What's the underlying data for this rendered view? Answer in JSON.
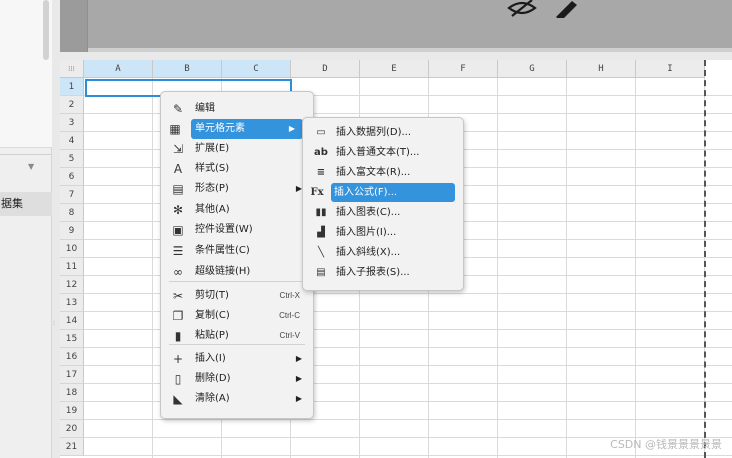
{
  "left_panel": {
    "item_label": "据集",
    "collapse_icon": "chevron-down-icon"
  },
  "columns": [
    "A",
    "B",
    "C",
    "D",
    "E",
    "F",
    "G",
    "H",
    "I"
  ],
  "rows": [
    "1",
    "2",
    "3",
    "4",
    "5",
    "6",
    "7",
    "8",
    "9",
    "10",
    "11",
    "12",
    "13",
    "14",
    "15",
    "16",
    "17",
    "18",
    "19",
    "20",
    "21"
  ],
  "context_menu": {
    "items": [
      {
        "label": "编辑",
        "icon": "pencil-icon"
      },
      {
        "label": "单元格元素",
        "icon": "cell-element-icon",
        "submenu": true,
        "highlighted": true
      },
      {
        "label": "扩展(E)",
        "icon": "expand-icon"
      },
      {
        "label": "样式(S)",
        "icon": "style-icon"
      },
      {
        "label": "形态(P)",
        "icon": "form-icon",
        "submenu": true
      },
      {
        "label": "其他(A)",
        "icon": "gear-icon"
      },
      {
        "label": "控件设置(W)",
        "icon": "widget-icon"
      },
      {
        "label": "条件属性(C)",
        "icon": "condition-icon"
      },
      {
        "label": "超级链接(H)",
        "icon": "link-icon"
      },
      {
        "label": "剪切(T)",
        "icon": "scissors-icon",
        "shortcut": "Ctrl-X"
      },
      {
        "label": "复制(C)",
        "icon": "copy-icon",
        "shortcut": "Ctrl-C"
      },
      {
        "label": "粘贴(P)",
        "icon": "paste-icon",
        "shortcut": "Ctrl-V"
      },
      {
        "label": "插入(I)",
        "icon": "plus-icon",
        "submenu": true
      },
      {
        "label": "删除(D)",
        "icon": "trash-icon",
        "submenu": true
      },
      {
        "label": "清除(A)",
        "icon": "eraser-icon",
        "submenu": true
      }
    ]
  },
  "submenu": {
    "items": [
      {
        "label": "插入数据列(D)...",
        "icon": "data-column-icon"
      },
      {
        "label": "插入普通文本(T)...",
        "icon": "text-ab-icon"
      },
      {
        "label": "插入富文本(R)...",
        "icon": "rich-text-icon"
      },
      {
        "label": "插入公式(F)...",
        "icon": "formula-icon",
        "highlighted": true
      },
      {
        "label": "插入图表(C)...",
        "icon": "chart-icon"
      },
      {
        "label": "插入图片(I)...",
        "icon": "image-icon"
      },
      {
        "label": "插入斜线(X)...",
        "icon": "slash-icon"
      },
      {
        "label": "插入子报表(S)...",
        "icon": "sub-report-icon"
      }
    ]
  },
  "watermark": "CSDN @钱景景景景景",
  "colors": {
    "highlight": "#3393dd",
    "selection": "#2b8ed8"
  }
}
